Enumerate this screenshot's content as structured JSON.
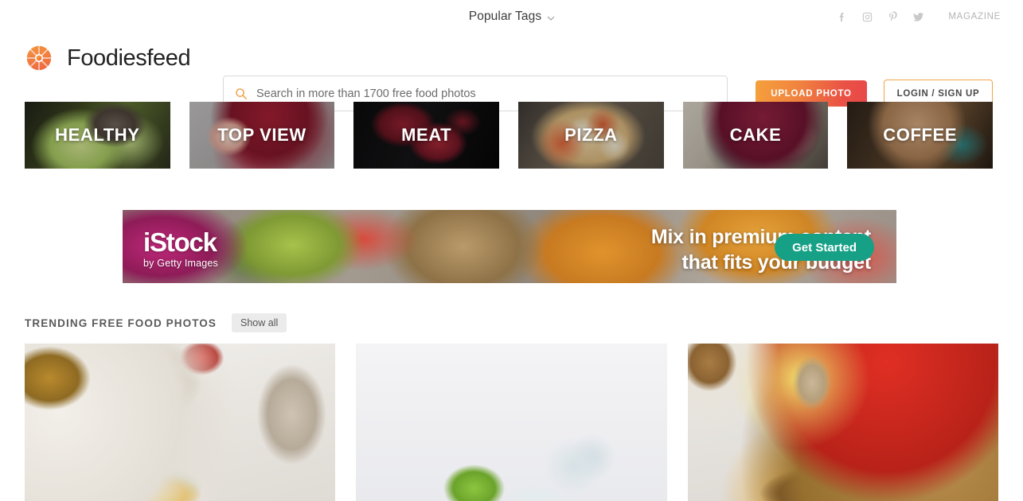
{
  "topbar": {
    "popular_tags_label": "Popular Tags",
    "magazine_label": "MAGAZINE",
    "social": [
      {
        "name": "facebook-icon",
        "label": "Facebook"
      },
      {
        "name": "instagram-icon",
        "label": "Instagram"
      },
      {
        "name": "pinterest-icon",
        "label": "Pinterest"
      },
      {
        "name": "twitter-icon",
        "label": "Twitter"
      }
    ]
  },
  "header": {
    "brand_name": "Foodiesfeed",
    "logo_icon": "aperture-logo-icon",
    "search": {
      "icon": "search-icon",
      "placeholder": "Search in more than 1700 free food photos",
      "value": ""
    },
    "upload_label": "UPLOAD PHOTO",
    "login_label": "LOGIN / SIGN UP"
  },
  "categories": [
    {
      "label": "HEALTHY",
      "bg": "bg-healthy"
    },
    {
      "label": "TOP VIEW",
      "bg": "bg-topview"
    },
    {
      "label": "MEAT",
      "bg": "bg-meat"
    },
    {
      "label": "PIZZA",
      "bg": "bg-pizza"
    },
    {
      "label": "CAKE",
      "bg": "bg-cake"
    },
    {
      "label": "COFFEE",
      "bg": "bg-coffee"
    }
  ],
  "banner": {
    "brand": "iStock",
    "sub_brand": "by Getty Images",
    "headline_line1": "Mix in premium content",
    "headline_line2": "that fits your budget",
    "cta_label": "Get Started",
    "cta_color": "#16a085"
  },
  "trending": {
    "title": "TRENDING FREE FOOD PHOTOS",
    "show_all_label": "Show all"
  },
  "photos": [
    {
      "alt": "Breakfast with tea, cherry tomatoes and egg toast",
      "bg": "ph-breakfast"
    },
    {
      "alt": "Lime slice splashing into water on white background",
      "bg": "ph-lime"
    },
    {
      "alt": "Flat lay with garlic, iced drink, vine tomatoes, burger and pepper mill",
      "bg": "ph-flatlay"
    }
  ],
  "colors": {
    "accent_orange": "#f0a34a",
    "accent_red": "#e8474a",
    "banner_teal": "#16a085"
  }
}
